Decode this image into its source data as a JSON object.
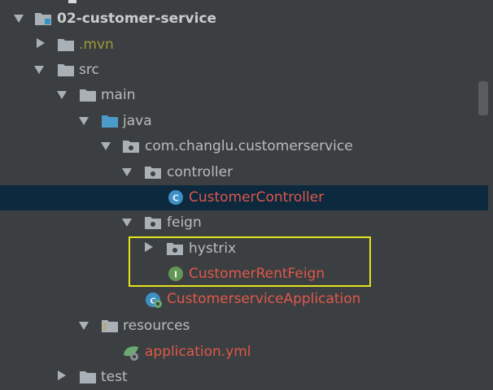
{
  "tree": {
    "rows": [
      {
        "label": "02-customer-service",
        "kind": "module",
        "expanded": true
      },
      {
        "label": ".mvn",
        "kind": "folder",
        "expanded": false
      },
      {
        "label": "src",
        "kind": "folder",
        "expanded": true
      },
      {
        "label": "main",
        "kind": "folder",
        "expanded": true
      },
      {
        "label": "java",
        "kind": "source-folder",
        "expanded": true
      },
      {
        "label": "com.changlu.customerservice",
        "kind": "package",
        "expanded": true
      },
      {
        "label": "controller",
        "kind": "package",
        "expanded": true
      },
      {
        "label": "CustomerController",
        "kind": "class",
        "selected": true
      },
      {
        "label": "feign",
        "kind": "package",
        "expanded": true
      },
      {
        "label": "hystrix",
        "kind": "package",
        "expanded": false
      },
      {
        "label": "CustomerRentFeign",
        "kind": "interface"
      },
      {
        "label": "CustomerserviceApplication",
        "kind": "spring-app"
      },
      {
        "label": "resources",
        "kind": "resources-folder",
        "expanded": true
      },
      {
        "label": "application.yml",
        "kind": "yml"
      },
      {
        "label": "test",
        "kind": "folder",
        "expanded": false
      }
    ]
  },
  "colors": {
    "background": "#3c3f41",
    "selection": "#0d293e",
    "highlight_box": "#e3e31d",
    "error_text": "#e0574a",
    "mvn_text": "#9c9a3b"
  }
}
